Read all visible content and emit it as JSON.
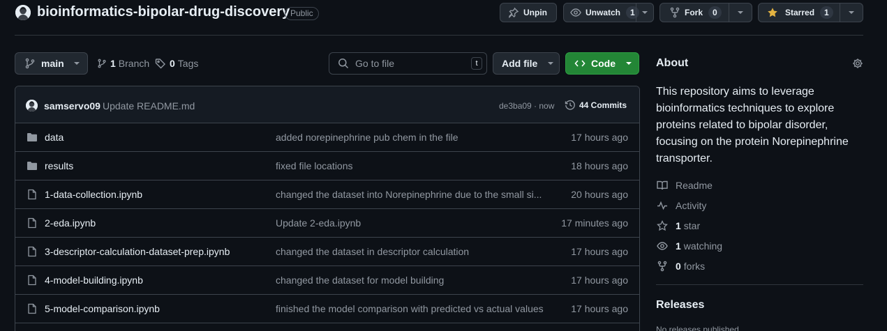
{
  "repo": {
    "name": "bioinformatics-bipolar-drug-discovery",
    "visibility": "Public"
  },
  "header_actions": {
    "unpin": "Unpin",
    "unwatch": "Unwatch",
    "watch_count": "1",
    "fork": "Fork",
    "fork_count": "0",
    "starred": "Starred",
    "star_count": "1"
  },
  "toolbar": {
    "branch": "main",
    "branch_count": "1",
    "branch_label": "Branch",
    "tag_count": "0",
    "tag_label": "Tags",
    "search_placeholder": "Go to file",
    "search_kbd": "t",
    "add_file": "Add file",
    "code": "Code"
  },
  "latest_commit": {
    "author": "samservo09",
    "message": "Update README.md",
    "hash_time": "de3ba09 · now",
    "commits": "44 Commits"
  },
  "files": [
    {
      "type": "folder",
      "name": "data",
      "message": "added norepinephrine pub chem in the file",
      "time": "17 hours ago"
    },
    {
      "type": "folder",
      "name": "results",
      "message": "fixed file locations",
      "time": "18 hours ago"
    },
    {
      "type": "file",
      "name": "1-data-collection.ipynb",
      "message": "changed the dataset into Norepinephrine due to the small si...",
      "time": "20 hours ago"
    },
    {
      "type": "file",
      "name": "2-eda.ipynb",
      "message": "Update 2-eda.ipynb",
      "time": "17 minutes ago"
    },
    {
      "type": "file",
      "name": "3-descriptor-calculation-dataset-prep.ipynb",
      "message": "changed the dataset in descriptor calculation",
      "time": "17 hours ago"
    },
    {
      "type": "file",
      "name": "4-model-building.ipynb",
      "message": "changed the dataset for model building",
      "time": "17 hours ago"
    },
    {
      "type": "file",
      "name": "5-model-comparison.ipynb",
      "message": "finished the model comparison with predicted vs actual values",
      "time": "17 hours ago"
    }
  ],
  "about": {
    "title": "About",
    "description": "This repository aims to leverage bioinformatics techniques to explore proteins related to bipolar disorder, focusing on the protein Norepinephrine transporter.",
    "readme": "Readme",
    "activity": "Activity",
    "stars_count": "1",
    "stars_label": "star",
    "watching_count": "1",
    "watching_label": "watching",
    "forks_count": "0",
    "forks_label": "forks"
  },
  "releases": {
    "title": "Releases",
    "empty": "No releases published"
  },
  "colors": {
    "background": "#0d1117",
    "code_button": "#238636",
    "star_icon": "#e3b341",
    "muted_text": "#9198a1"
  }
}
